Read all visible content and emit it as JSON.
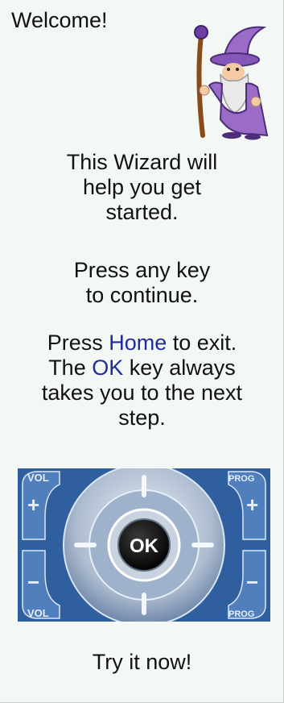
{
  "header": {
    "title": "Welcome!"
  },
  "intro": {
    "line1": "This Wizard will",
    "line2": "help you get",
    "line3": "started."
  },
  "continue_msg": {
    "line1": "Press any key",
    "line2": "to continue."
  },
  "exit_msg": {
    "press": "Press ",
    "home_key": "Home",
    "to_exit": " to exit.",
    "the": "The ",
    "ok_key": "OK",
    "always": " key always",
    "takes": "takes you to the next",
    "step": "step."
  },
  "remote": {
    "vol_label": "VOL",
    "prog_label": "PROG",
    "plus": "+",
    "minus": "−",
    "ok_label": "OK"
  },
  "footer": {
    "try_text": "Try it now!"
  },
  "colors": {
    "highlight": "#1f2c9a",
    "remote_blue": "#2f5f9f"
  },
  "icons": {
    "mascot": "wizard-icon"
  }
}
